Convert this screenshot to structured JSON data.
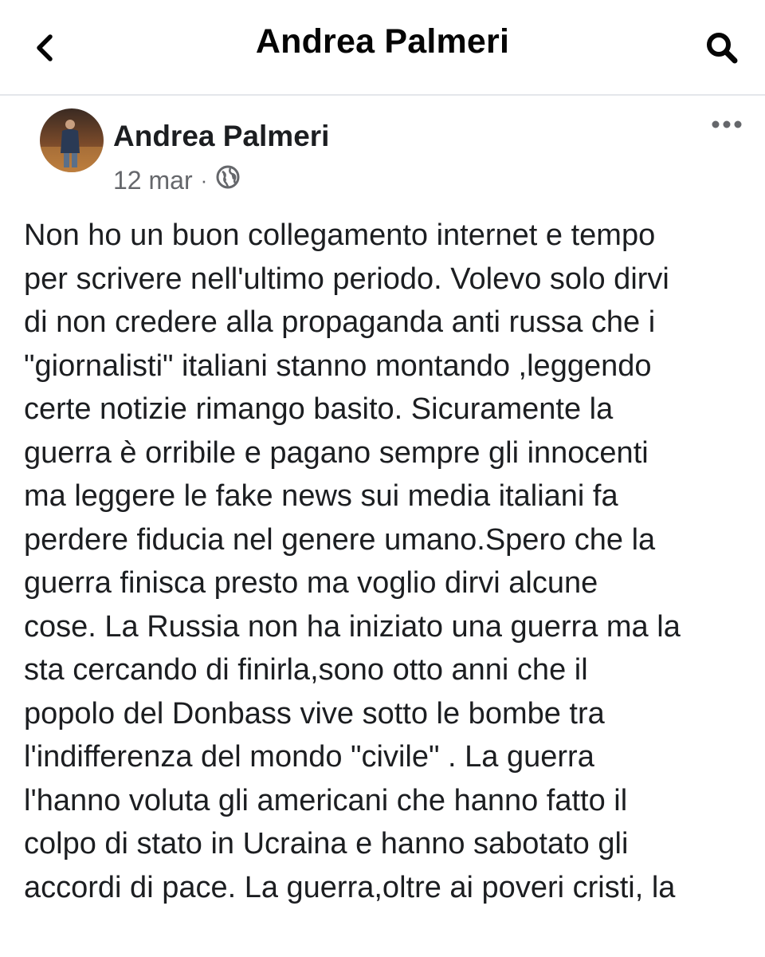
{
  "header": {
    "title": "Andrea Palmeri",
    "back_icon": "chevron-left-icon",
    "search_icon": "search-icon"
  },
  "post": {
    "author": "Andrea Palmeri",
    "date": "12 mar",
    "separator": "·",
    "privacy_icon": "globe-icon",
    "more_icon": "more-horizontal-icon",
    "text": "Non ho un buon collegamento internet e tempo\nper scrivere nell'ultimo periodo. Volevo solo dirvi\ndi non credere alla propaganda anti russa che i\n\"giornalisti\" italiani stanno montando ,leggendo\ncerte notizie rimango basito. Sicuramente la\nguerra è orribile e pagano sempre gli innocenti\nma leggere le fake news sui media italiani fa\nperdere fiducia nel genere umano.Spero che la\nguerra finisca presto ma voglio dirvi alcune\ncose. La Russia non ha iniziato una guerra ma la\nsta cercando di finirla,sono otto anni che il\npopolo del Donbass vive sotto le bombe tra\nl'indifferenza del mondo \"civile\" . La guerra\nl'hanno voluta gli americani che hanno fatto il\ncolpo di stato in Ucraina e hanno sabotato gli\naccordi di pace. La guerra,oltre ai poveri cristi, la"
  },
  "colors": {
    "text_primary": "#1c1e21",
    "text_secondary": "#65676b",
    "divider": "#e4e6eb",
    "background": "#ffffff"
  }
}
